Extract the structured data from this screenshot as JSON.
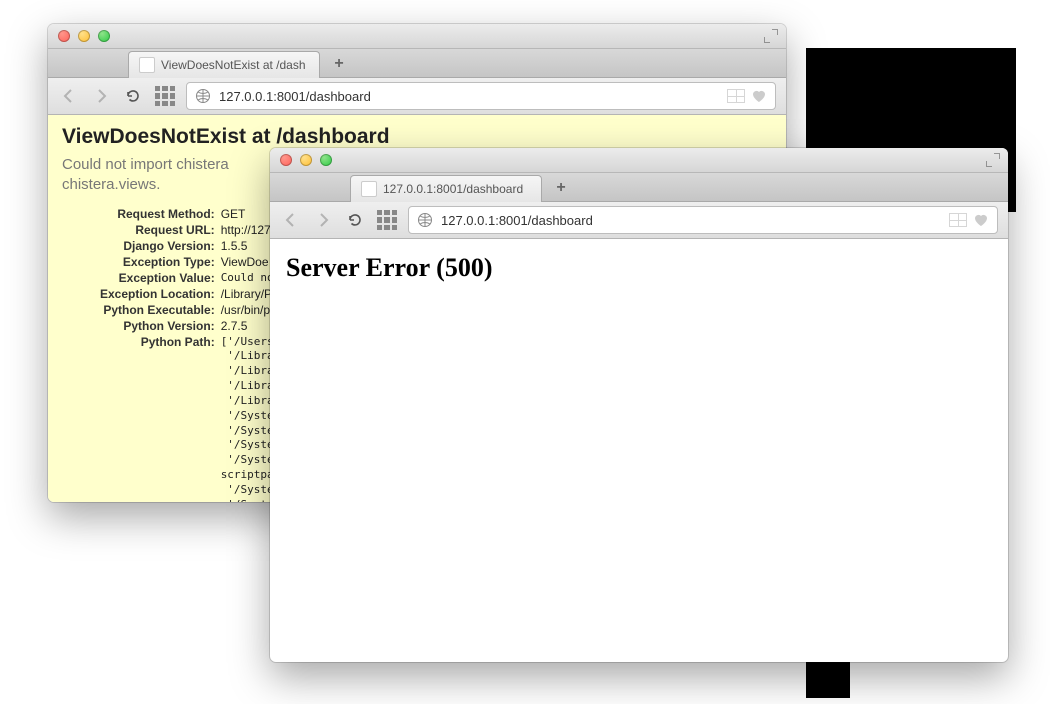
{
  "window1": {
    "tab_title": "ViewDoesNotExist at /dash",
    "url": "127.0.0.1:8001/dashboard",
    "heading": "ViewDoesNotExist at /dashboard",
    "subtitle_line1": "Could not import chistera",
    "subtitle_line2": "chistera.views.",
    "meta": {
      "request_method": "GET",
      "request_url": "http://127",
      "django_version": "1.5.5",
      "exception_type": "ViewDoe",
      "exception_value": "Could not",
      "exception_location": "/Library/P",
      "python_executable": "/usr/bin/p",
      "python_version": "2.7.5"
    },
    "python_path": "['/Users\n '/Libra\n '/Libra\n '/Libra\n '/Libra\n '/Syste\n '/Syste\n '/Syste\n '/Syste\nscriptpac\n '/Syste\n '/Syste\n '/Syste"
  },
  "window2": {
    "tab_title": "127.0.0.1:8001/dashboard",
    "url": "127.0.0.1:8001/dashboard",
    "heading": "Server Error (500)"
  },
  "labels": {
    "request_method": "Request Method:",
    "request_url": "Request URL:",
    "django_version": "Django Version:",
    "exception_type": "Exception Type:",
    "exception_value": "Exception Value:",
    "exception_location": "Exception Location:",
    "python_executable": "Python Executable:",
    "python_version": "Python Version:",
    "python_path": "Python Path:"
  }
}
